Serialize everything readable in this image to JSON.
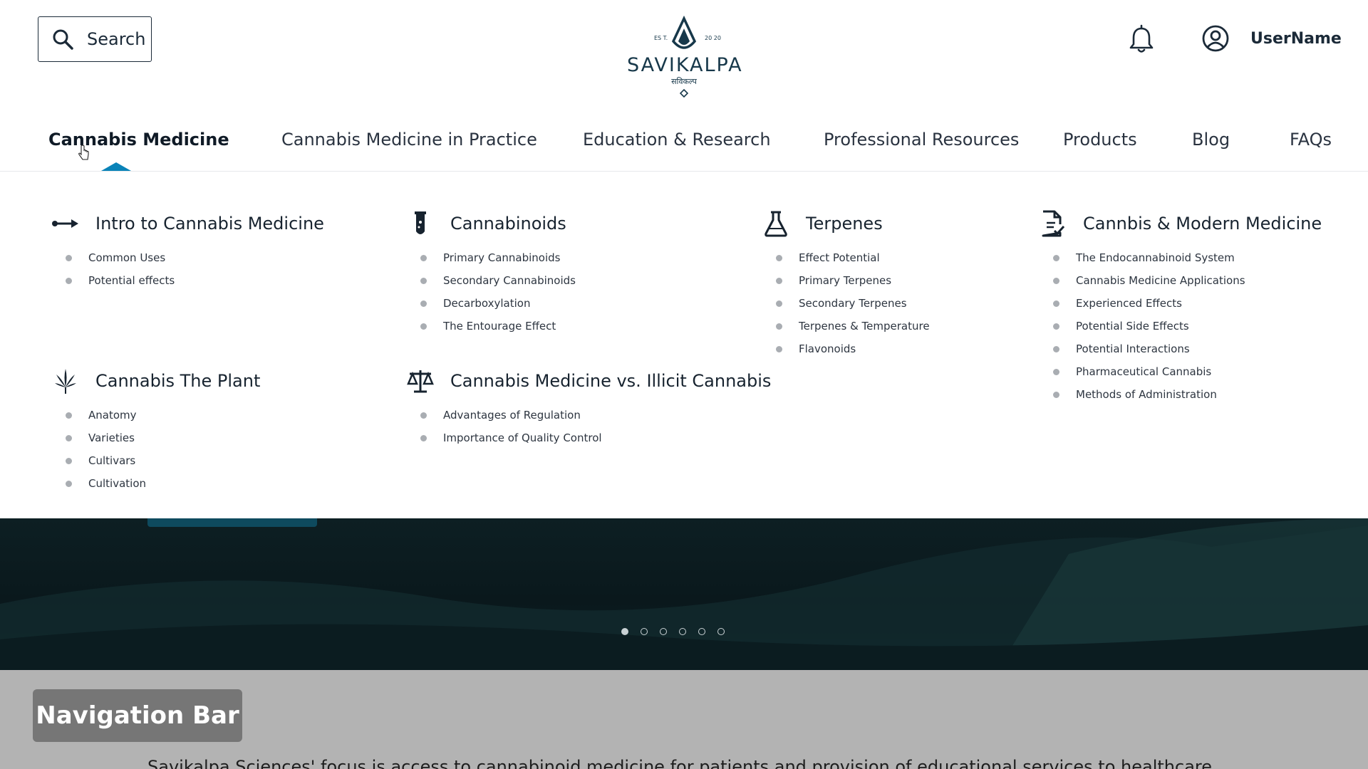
{
  "header": {
    "search_label": "Search",
    "logo": {
      "name": "SAVIKALPA",
      "sub": "सविकल्प",
      "est_left": "ES T.",
      "est_right": "20 20"
    },
    "username": "UserName"
  },
  "nav": {
    "items": [
      {
        "label": "Cannabis Medicine",
        "active": true
      },
      {
        "label": "Cannabis Medicine in Practice"
      },
      {
        "label": "Education & Research"
      },
      {
        "label": "Professional Resources"
      },
      {
        "label": "Products"
      },
      {
        "label": "Blog"
      },
      {
        "label": "FAQs"
      }
    ],
    "accent": "#0a83b8"
  },
  "mega": {
    "groups": [
      {
        "title": "Intro to Cannabis Medicine",
        "icon": "arrow-right-icon",
        "items": [
          "Common Uses",
          "Potential effects"
        ]
      },
      {
        "title": "Cannabinoids",
        "icon": "test-tube-icon",
        "items": [
          "Primary Cannabinoids",
          "Secondary Cannabinoids",
          "Decarboxylation",
          "The Entourage Effect"
        ]
      },
      {
        "title": "Terpenes",
        "icon": "flask-icon",
        "items": [
          "Effect Potential",
          "Primary Terpenes",
          "Secondary Terpenes",
          "Terpenes & Temperature",
          "Flavonoids"
        ]
      },
      {
        "title": "Cannbis & Modern Medicine",
        "icon": "document-check-icon",
        "items": [
          "The Endocannabinoid System",
          "Cannabis Medicine Applications",
          "Experienced Effects",
          "Potential Side Effects",
          "Potential Interactions",
          "Pharmaceutical Cannabis",
          "Methods of Administration"
        ]
      },
      {
        "title": "Cannabis The Plant",
        "icon": "cannabis-leaf-icon",
        "items": [
          "Anatomy",
          "Varieties",
          "Cultivars",
          "Cultivation"
        ]
      },
      {
        "title": "Cannabis Medicine vs. Illicit Cannabis",
        "icon": "scales-icon",
        "items": [
          "Advantages of Regulation",
          "Importance of Quality Control"
        ]
      }
    ]
  },
  "hero": {
    "slides": 6,
    "active_slide": 1
  },
  "annotation": {
    "label": "Navigation Bar"
  },
  "intro_text": "Savikalpa Sciences' focus is access to cannabinoid medicine for patients and provision of educational services to healthcare"
}
